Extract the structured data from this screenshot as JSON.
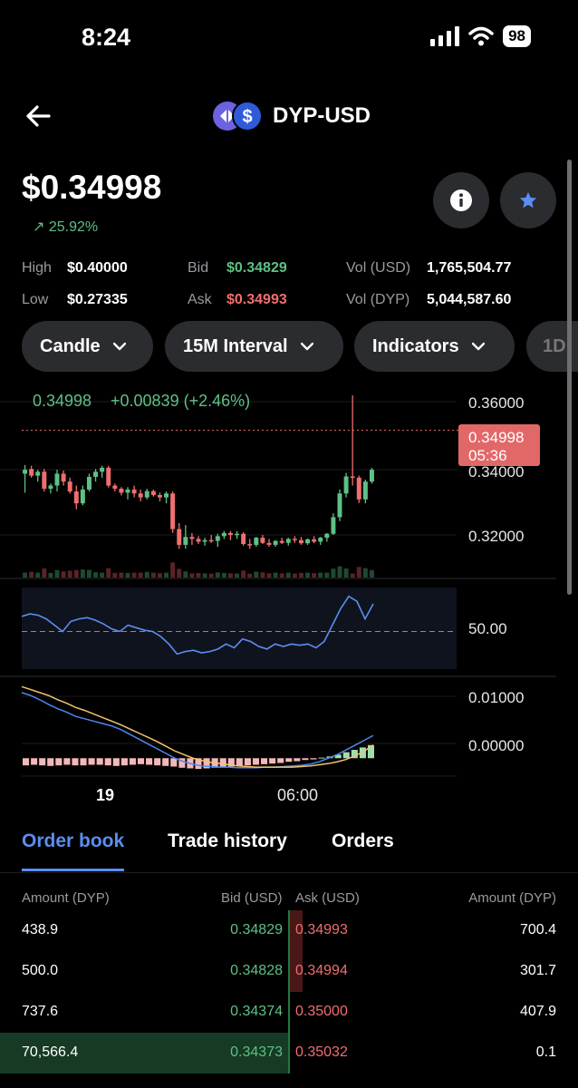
{
  "status": {
    "time": "8:24",
    "battery": "98"
  },
  "header": {
    "pair": "DYP-USD"
  },
  "price": {
    "current": "$0.34998",
    "change": "25.92%"
  },
  "stats": {
    "high_label": "High",
    "high": "$0.40000",
    "low_label": "Low",
    "low": "$0.27335",
    "bid_label": "Bid",
    "bid": "$0.34829",
    "ask_label": "Ask",
    "ask": "$0.34993",
    "vol_usd_label": "Vol (USD)",
    "vol_usd": "1,765,504.77",
    "vol_dyp_label": "Vol (DYP)",
    "vol_dyp": "5,044,587.60"
  },
  "pills": [
    "Candle",
    "15M Interval",
    "Indicators",
    "1D"
  ],
  "chart_overlay": {
    "last": "0.34998",
    "delta": "+0.00839 (+2.46%)",
    "tag_price": "0.34998",
    "tag_time": "05:36"
  },
  "chart_data": [
    {
      "type": "candlestick",
      "y_ticks": [
        "0.36000",
        "0.34000",
        "0.32000"
      ],
      "ylim": [
        0.3125,
        0.3625
      ],
      "current_price": 0.34998,
      "candles": [
        {
          "o": 0.339,
          "h": 0.3412,
          "l": 0.3342,
          "c": 0.34
        },
        {
          "o": 0.3402,
          "h": 0.341,
          "l": 0.338,
          "c": 0.3385
        },
        {
          "o": 0.3385,
          "h": 0.34,
          "l": 0.337,
          "c": 0.3395
        },
        {
          "o": 0.3395,
          "h": 0.3402,
          "l": 0.3345,
          "c": 0.3352
        },
        {
          "o": 0.3352,
          "h": 0.3365,
          "l": 0.334,
          "c": 0.336
        },
        {
          "o": 0.336,
          "h": 0.34,
          "l": 0.3345,
          "c": 0.339
        },
        {
          "o": 0.339,
          "h": 0.3398,
          "l": 0.336,
          "c": 0.337
        },
        {
          "o": 0.337,
          "h": 0.338,
          "l": 0.334,
          "c": 0.3345
        },
        {
          "o": 0.3345,
          "h": 0.336,
          "l": 0.33,
          "c": 0.3315
        },
        {
          "o": 0.3315,
          "h": 0.336,
          "l": 0.331,
          "c": 0.335
        },
        {
          "o": 0.335,
          "h": 0.339,
          "l": 0.3345,
          "c": 0.3382
        },
        {
          "o": 0.3382,
          "h": 0.3402,
          "l": 0.337,
          "c": 0.3395
        },
        {
          "o": 0.3395,
          "h": 0.341,
          "l": 0.338,
          "c": 0.3405
        },
        {
          "o": 0.3405,
          "h": 0.341,
          "l": 0.3355,
          "c": 0.336
        },
        {
          "o": 0.336,
          "h": 0.3365,
          "l": 0.3345,
          "c": 0.3352
        },
        {
          "o": 0.3352,
          "h": 0.3356,
          "l": 0.3335,
          "c": 0.3342
        },
        {
          "o": 0.3342,
          "h": 0.3356,
          "l": 0.3325,
          "c": 0.335
        },
        {
          "o": 0.335,
          "h": 0.336,
          "l": 0.333,
          "c": 0.334
        },
        {
          "o": 0.334,
          "h": 0.335,
          "l": 0.332,
          "c": 0.333
        },
        {
          "o": 0.333,
          "h": 0.3352,
          "l": 0.3325,
          "c": 0.3346
        },
        {
          "o": 0.3346,
          "h": 0.335,
          "l": 0.3332,
          "c": 0.3336
        },
        {
          "o": 0.3336,
          "h": 0.3342,
          "l": 0.332,
          "c": 0.333
        },
        {
          "o": 0.333,
          "h": 0.3345,
          "l": 0.3315,
          "c": 0.334
        },
        {
          "o": 0.334,
          "h": 0.3345,
          "l": 0.324,
          "c": 0.325
        },
        {
          "o": 0.325,
          "h": 0.3265,
          "l": 0.32,
          "c": 0.321
        },
        {
          "o": 0.321,
          "h": 0.326,
          "l": 0.32,
          "c": 0.323
        },
        {
          "o": 0.323,
          "h": 0.324,
          "l": 0.321,
          "c": 0.3225
        },
        {
          "o": 0.3225,
          "h": 0.3232,
          "l": 0.3212,
          "c": 0.3218
        },
        {
          "o": 0.3218,
          "h": 0.3228,
          "l": 0.3208,
          "c": 0.3222
        },
        {
          "o": 0.3222,
          "h": 0.3235,
          "l": 0.3215,
          "c": 0.322
        },
        {
          "o": 0.322,
          "h": 0.3238,
          "l": 0.3205,
          "c": 0.3232
        },
        {
          "o": 0.3232,
          "h": 0.3245,
          "l": 0.3225,
          "c": 0.324
        },
        {
          "o": 0.324,
          "h": 0.3245,
          "l": 0.3222,
          "c": 0.3235
        },
        {
          "o": 0.3235,
          "h": 0.3245,
          "l": 0.3225,
          "c": 0.3238
        },
        {
          "o": 0.3238,
          "h": 0.3242,
          "l": 0.3208,
          "c": 0.3212
        },
        {
          "o": 0.3212,
          "h": 0.3225,
          "l": 0.32,
          "c": 0.321
        },
        {
          "o": 0.321,
          "h": 0.323,
          "l": 0.3205,
          "c": 0.3228
        },
        {
          "o": 0.3228,
          "h": 0.3235,
          "l": 0.3212,
          "c": 0.3215
        },
        {
          "o": 0.3215,
          "h": 0.3225,
          "l": 0.3205,
          "c": 0.321
        },
        {
          "o": 0.321,
          "h": 0.3222,
          "l": 0.3205,
          "c": 0.322
        },
        {
          "o": 0.322,
          "h": 0.3228,
          "l": 0.3212,
          "c": 0.3215
        },
        {
          "o": 0.3215,
          "h": 0.3228,
          "l": 0.3208,
          "c": 0.3225
        },
        {
          "o": 0.3225,
          "h": 0.3232,
          "l": 0.3215,
          "c": 0.3222
        },
        {
          "o": 0.3222,
          "h": 0.323,
          "l": 0.321,
          "c": 0.3214
        },
        {
          "o": 0.3214,
          "h": 0.3226,
          "l": 0.321,
          "c": 0.3224
        },
        {
          "o": 0.3224,
          "h": 0.3232,
          "l": 0.3214,
          "c": 0.3218
        },
        {
          "o": 0.3218,
          "h": 0.323,
          "l": 0.321,
          "c": 0.3228
        },
        {
          "o": 0.3228,
          "h": 0.324,
          "l": 0.3218,
          "c": 0.3238
        },
        {
          "o": 0.3238,
          "h": 0.329,
          "l": 0.3235,
          "c": 0.328
        },
        {
          "o": 0.328,
          "h": 0.335,
          "l": 0.327,
          "c": 0.334
        },
        {
          "o": 0.334,
          "h": 0.3392,
          "l": 0.333,
          "c": 0.3383
        },
        {
          "o": 0.3383,
          "h": 0.3588,
          "l": 0.336,
          "c": 0.338
        },
        {
          "o": 0.338,
          "h": 0.3385,
          "l": 0.3316,
          "c": 0.3325
        },
        {
          "o": 0.3325,
          "h": 0.3375,
          "l": 0.3315,
          "c": 0.337
        },
        {
          "o": 0.337,
          "h": 0.3405,
          "l": 0.3365,
          "c": 0.34
        }
      ]
    },
    {
      "type": "line",
      "y_ticks": [
        "50.00"
      ],
      "ylim": [
        20,
        85
      ],
      "values": [
        62,
        64,
        63,
        60,
        55,
        50,
        58,
        60,
        61,
        59,
        56,
        52,
        50,
        55,
        53,
        51,
        50,
        46,
        40,
        32,
        34,
        35,
        33,
        34,
        36,
        40,
        37,
        44,
        42,
        38,
        36,
        40,
        38,
        40,
        39,
        40,
        37,
        42,
        55,
        68,
        78,
        74,
        60,
        72
      ]
    },
    {
      "type": "bar",
      "y_ticks": [
        "0.01000",
        "0.00000"
      ],
      "ylim": [
        -0.003,
        0.0125
      ],
      "histogram": [
        -0.0012,
        -0.0011,
        -0.0012,
        -0.0013,
        -0.0012,
        -0.0011,
        -0.0012,
        -0.0012,
        -0.0011,
        -0.0011,
        -0.0012,
        -0.0013,
        -0.0012,
        -0.0011,
        -0.001,
        -0.0011,
        -0.0012,
        -0.0013,
        -0.0014,
        -0.0016,
        -0.0017,
        -0.0018,
        -0.0017,
        -0.0016,
        -0.0015,
        -0.0014,
        -0.0013,
        -0.0012,
        -0.0011,
        -0.001,
        -0.0009,
        -0.0008,
        -0.0006,
        -0.0005,
        -0.0003,
        -0.0002,
        0.0001,
        0.0003,
        0.0006,
        0.001,
        0.0014,
        0.0018,
        0.0022
      ],
      "macd": [
        0.011,
        0.0105,
        0.0098,
        0.009,
        0.0083,
        0.0077,
        0.007,
        0.0066,
        0.0062,
        0.0058,
        0.0054,
        0.0048,
        0.004,
        0.0032,
        0.0024,
        0.0016,
        0.0008,
        0.0,
        -0.0006,
        -0.001,
        -0.0013,
        -0.0014,
        -0.0015,
        -0.0015,
        -0.0016,
        -0.0016,
        -0.0016,
        -0.0015,
        -0.0015,
        -0.0014,
        -0.0013,
        -0.0012,
        -0.001,
        -0.0006,
        0.0,
        0.0006,
        0.0014,
        0.0022,
        0.003,
        0.0038
      ],
      "signal": [
        0.012,
        0.0115,
        0.011,
        0.0105,
        0.0098,
        0.0092,
        0.0085,
        0.008,
        0.0074,
        0.0068,
        0.0062,
        0.0056,
        0.0049,
        0.0042,
        0.0035,
        0.0028,
        0.002,
        0.0012,
        0.0006,
        0.0,
        -0.0004,
        -0.0007,
        -0.0009,
        -0.0011,
        -0.0013,
        -0.0014,
        -0.0015,
        -0.0015,
        -0.0015,
        -0.0015,
        -0.0015,
        -0.0014,
        -0.0013,
        -0.0011,
        -0.0009,
        -0.0006,
        -0.0002,
        0.0004,
        0.0012,
        0.0022
      ]
    }
  ],
  "x_ticks": [
    "19",
    "06:00"
  ],
  "tabs": [
    "Order book",
    "Trade history",
    "Orders"
  ],
  "orderbook": {
    "headers": [
      "Amount (DYP)",
      "Bid (USD)",
      "Ask (USD)",
      "Amount (DYP)"
    ],
    "rows": [
      {
        "bid_amt": "438.9",
        "bid": "0.34829",
        "ask": "0.34993",
        "ask_amt": "700.4"
      },
      {
        "bid_amt": "500.0",
        "bid": "0.34828",
        "ask": "0.34994",
        "ask_amt": "301.7"
      },
      {
        "bid_amt": "737.6",
        "bid": "0.34374",
        "ask": "0.35000",
        "ask_amt": "407.9"
      },
      {
        "bid_amt": "70,566.4",
        "bid": "0.34373",
        "ask": "0.35032",
        "ask_amt": "0.1"
      }
    ]
  },
  "colors": {
    "up": "#5dc184",
    "down": "#ef6f6f",
    "accent": "#5b8ef0",
    "pill": "#2b2c30"
  }
}
